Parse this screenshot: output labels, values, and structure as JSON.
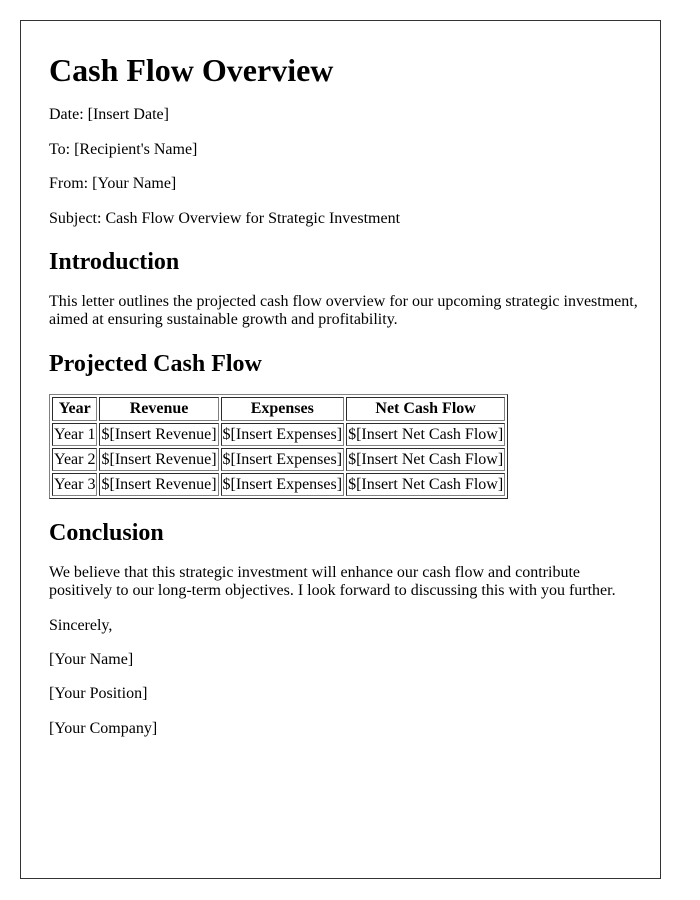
{
  "title": "Cash Flow Overview",
  "meta": {
    "date": "Date: [Insert Date]",
    "to": "To: [Recipient's Name]",
    "from": "From: [Your Name]",
    "subject": "Subject: Cash Flow Overview for Strategic Investment"
  },
  "introduction": {
    "heading": "Introduction",
    "text": "This letter outlines the projected cash flow overview for our upcoming strategic investment, aimed at ensuring sustainable growth and profitability."
  },
  "projected": {
    "heading": "Projected Cash Flow",
    "columns": [
      "Year",
      "Revenue",
      "Expenses",
      "Net Cash Flow"
    ],
    "rows": [
      [
        "Year 1",
        "$[Insert Revenue]",
        "$[Insert Expenses]",
        "$[Insert Net Cash Flow]"
      ],
      [
        "Year 2",
        "$[Insert Revenue]",
        "$[Insert Expenses]",
        "$[Insert Net Cash Flow]"
      ],
      [
        "Year 3",
        "$[Insert Revenue]",
        "$[Insert Expenses]",
        "$[Insert Net Cash Flow]"
      ]
    ]
  },
  "conclusion": {
    "heading": "Conclusion",
    "text": "We believe that this strategic investment will enhance our cash flow and contribute positively to our long-term objectives. I look forward to discussing this with you further."
  },
  "closing": {
    "salutation": "Sincerely,",
    "name": "[Your Name]",
    "position": "[Your Position]",
    "company": "[Your Company]"
  }
}
